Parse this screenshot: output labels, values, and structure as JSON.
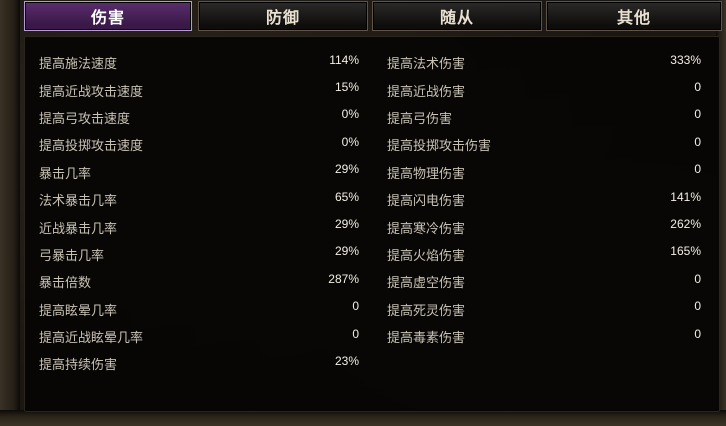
{
  "tabs": [
    {
      "label": "伤害",
      "active": true
    },
    {
      "label": "防御",
      "active": false
    },
    {
      "label": "随从",
      "active": false
    },
    {
      "label": "其他",
      "active": false
    }
  ],
  "left_stats": [
    {
      "label": "提高施法速度",
      "value": "114%"
    },
    {
      "label": "提高近战攻击速度",
      "value": "15%"
    },
    {
      "label": "提高弓攻击速度",
      "value": "0%"
    },
    {
      "label": "提高投掷攻击速度",
      "value": "0%"
    },
    {
      "label": "暴击几率",
      "value": "29%"
    },
    {
      "label": "法术暴击几率",
      "value": "65%"
    },
    {
      "label": "近战暴击几率",
      "value": "29%"
    },
    {
      "label": "弓暴击几率",
      "value": "29%"
    },
    {
      "label": "暴击倍数",
      "value": "287%"
    },
    {
      "label": "提高眩晕几率",
      "value": "0"
    },
    {
      "label": "提高近战眩晕几率",
      "value": "0"
    },
    {
      "label": "提高持续伤害",
      "value": "23%"
    }
  ],
  "right_stats": [
    {
      "label": "提高法术伤害",
      "value": "333%"
    },
    {
      "label": "提高近战伤害",
      "value": "0"
    },
    {
      "label": "提高弓伤害",
      "value": "0"
    },
    {
      "label": "提高投掷攻击伤害",
      "value": "0"
    },
    {
      "label": "提高物理伤害",
      "value": "0"
    },
    {
      "label": "提高闪电伤害",
      "value": "141%"
    },
    {
      "label": "提高寒冷伤害",
      "value": "262%"
    },
    {
      "label": "提高火焰伤害",
      "value": "165%"
    },
    {
      "label": "提高虚空伤害",
      "value": "0"
    },
    {
      "label": "提高死灵伤害",
      "value": "0"
    },
    {
      "label": "提高毒素伤害",
      "value": "0"
    }
  ],
  "colors": {
    "active_tab": "#4a2360",
    "label_text": "#c8c2b6",
    "value_text": "#f3efe6"
  }
}
